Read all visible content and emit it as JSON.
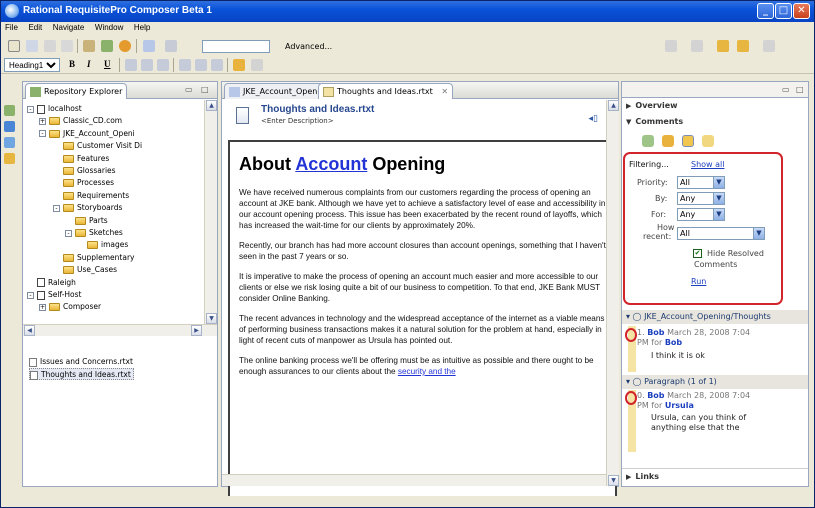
{
  "window": {
    "title": "Rational RequisitePro Composer Beta 1"
  },
  "menu": [
    "File",
    "Edit",
    "Navigate",
    "Window",
    "Help"
  ],
  "toolbar": {
    "advanced_label": "Advanced...",
    "style_value": "Heading1",
    "bold": "B",
    "italic": "I",
    "underline": "U"
  },
  "repo": {
    "tab_label": "Repository Explorer",
    "tree": [
      {
        "label": "localhost",
        "icon": "database-icon",
        "expander": "-"
      },
      {
        "label": "Classic_CD.com",
        "icon": "folder-icon",
        "expander": "+"
      },
      {
        "label": "JKE_Account_Openi",
        "icon": "folder-icon",
        "expander": "-"
      },
      {
        "label": "Customer Visit Di",
        "icon": "folder-icon",
        "expander": ""
      },
      {
        "label": "Features",
        "icon": "folder-icon",
        "expander": ""
      },
      {
        "label": "Glossaries",
        "icon": "folder-icon",
        "expander": ""
      },
      {
        "label": "Processes",
        "icon": "folder-icon",
        "expander": ""
      },
      {
        "label": "Requirements",
        "icon": "folder-icon",
        "expander": ""
      },
      {
        "label": "Storyboards",
        "icon": "folder-icon",
        "expander": "-"
      },
      {
        "label": "Parts",
        "icon": "folder-icon",
        "expander": ""
      },
      {
        "label": "Sketches",
        "icon": "folder-icon",
        "expander": "-"
      },
      {
        "label": "images",
        "icon": "folder-icon",
        "expander": ""
      },
      {
        "label": "Supplementary",
        "icon": "folder-icon",
        "expander": ""
      },
      {
        "label": "Use_Cases",
        "icon": "folder-icon",
        "expander": ""
      },
      {
        "label": "Raleigh",
        "icon": "database-icon",
        "expander": ""
      },
      {
        "label": "Self-Host",
        "icon": "database-icon",
        "expander": "-"
      },
      {
        "label": "Composer",
        "icon": "folder-icon",
        "expander": "+"
      }
    ],
    "files": [
      "Issues and Concerns.rtxt",
      "Thoughts and Ideas.rtxt"
    ]
  },
  "editor": {
    "tabs": [
      "JKE_Account_Opening",
      "Thoughts and Ideas.rtxt"
    ],
    "doc_title": "Thoughts and Ideas.rtxt",
    "doc_desc": "<Enter Description>",
    "heading_pre": "About ",
    "heading_link": "Account",
    "heading_post": " Opening",
    "paragraphs": [
      "We have received numerous complaints from our customers regarding the process of opening an account at JKE bank.  Although we have yet to achieve a satisfactory level of ease and accessibility in our account opening process. This issue has been exacerbated by the recent round of layoffs, which has increased the wait-time for our clients by approximately 20%.",
      "Recently, our branch has had more account closures than account openings, something that I haven't seen in the past 7 years or so.",
      "It is imperative to make the process of opening an account much easier and more accessible to our clients or else we risk losing quite a bit of our business to competition.  To that end, JKE Bank MUST consider Online Banking.",
      "The recent advances in technology and the widespread acceptance of the internet as a viable means of performing business transactions makes it a natural solution for the problem at hand, especially in light of recent cuts of manpower as Ursula has pointed out.",
      "The online banking process we'll be offering must be as intuitive as possible and there ought to be enough assurances to our clients about the "
    ],
    "last_link": "security and the"
  },
  "right": {
    "overview": "Overview",
    "comments": "Comments",
    "links": "Links",
    "filtering": "Filtering...",
    "show_all": "Show all",
    "priority_label": "Priority:",
    "priority_value": "All",
    "by_label": "By:",
    "by_value": "Any",
    "for_label": "For:",
    "for_value": "Any",
    "recent_label1": "How",
    "recent_label2": "recent:",
    "recent_value": "All",
    "hide_resolved": "Hide Resolved",
    "hide_resolved2": "Comments",
    "run": "Run",
    "thread1": "JKE_Account_Opening/Thoughts",
    "c1_num": "1.",
    "c1_author": "Bob",
    "c1_date": "March 28, 2008 7:04",
    "c1_pm": "PM for",
    "c1_for": "Bob",
    "c1_text": "I think it is ok",
    "thread2": "Paragraph (1 of 1)",
    "c2_num": "0.",
    "c2_author": "Bob",
    "c2_date": "March 28, 2008 7:04",
    "c2_pm": "PM for",
    "c2_for": "Ursula",
    "c2_text1": "Ursula, can you think of",
    "c2_text2": "anything else that the"
  }
}
